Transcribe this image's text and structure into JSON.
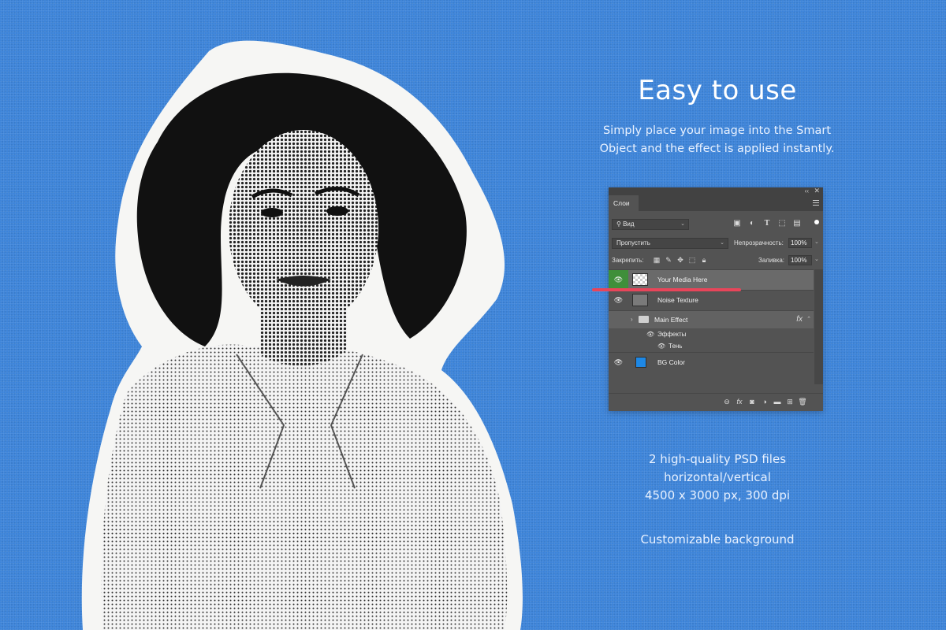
{
  "colors": {
    "background": "#3d84d9",
    "panel": "#535353",
    "accent_green": "#3f8f3a",
    "highlight": "#e8455a",
    "bg_color_swatch": "#1e88e5"
  },
  "heading": {
    "title": "Easy to use",
    "subtitle_line1": "Simply place your image into the Smart",
    "subtitle_line2": "Object and the effect is applied instantly."
  },
  "specs": {
    "line1": "2 high-quality PSD files",
    "line2": "horizontal/vertical",
    "line3": "4500 x 3000 px, 300 dpi",
    "custom": "Customizable background"
  },
  "panel": {
    "top_collapse": "‹‹",
    "top_close": "✕",
    "tab_label": "Слои",
    "filter_label": "Вид",
    "filter_icons": [
      "image-filter-icon",
      "adjustment-filter-icon",
      "type-filter-icon",
      "shape-filter-icon",
      "smart-object-filter-icon"
    ],
    "blend_mode": "Пропустить",
    "opacity_label": "Непрозрачность:",
    "opacity_value": "100%",
    "lock_label": "Закрепить:",
    "fill_label": "Заливка:",
    "fill_value": "100%",
    "layers": [
      {
        "name": "Your Media Here"
      },
      {
        "name": "Noise Texture"
      },
      {
        "name": "Main Effect",
        "fx": "fx"
      },
      {
        "name": "BG Color"
      }
    ],
    "effects_label": "Эффекты",
    "shadow_label": "Тень"
  }
}
